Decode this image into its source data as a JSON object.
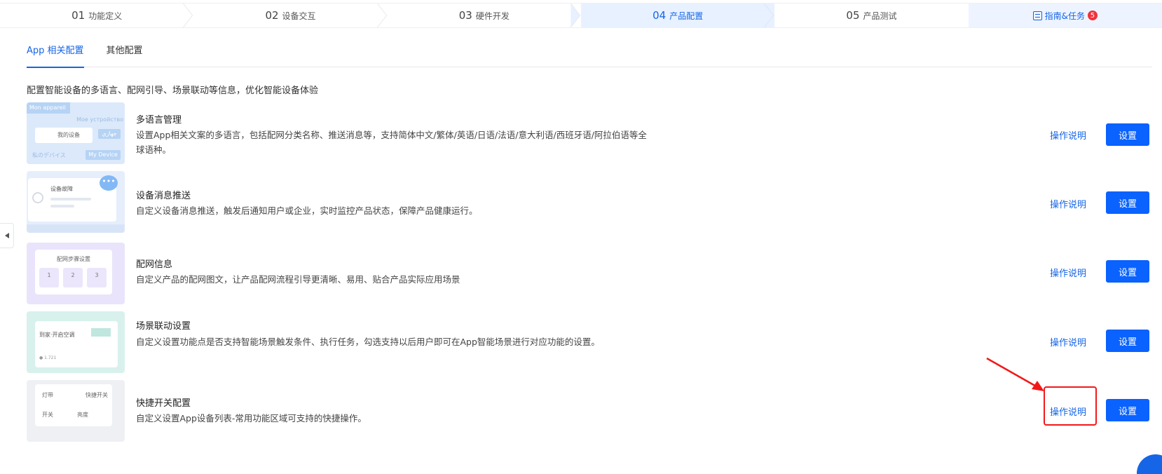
{
  "steps": [
    {
      "num": "01",
      "label": "功能定义"
    },
    {
      "num": "02",
      "label": "设备交互"
    },
    {
      "num": "03",
      "label": "硬件开发"
    },
    {
      "num": "04",
      "label": "产品配置"
    },
    {
      "num": "05",
      "label": "产品测试"
    }
  ],
  "guide": {
    "label": "指南&任务",
    "badge": "5"
  },
  "tabs": [
    {
      "label": "App 相关配置"
    },
    {
      "label": "其他配置"
    }
  ],
  "description": "配置智能设备的多语言、配网引导、场景联动等信息，优化智能设备体验",
  "items": [
    {
      "title": "多语言管理",
      "text": "设置App相关文案的多语言，包括配网分类名称、推送消息等，支持简体中文/繁体/英语/日语/法语/意大利语/西班牙语/阿拉伯语等全球语种。",
      "help": "操作说明",
      "button": "设置",
      "thumb": {
        "a": "Mon appareil",
        "b": "Мое устройство",
        "c": "我的设备",
        "d": "جهازي",
        "e": "私のデバイス",
        "f": "My Device"
      }
    },
    {
      "title": "设备消息推送",
      "text": "自定义设备消息推送，触发后通知用户或企业，实时监控产品状态，保障产品健康运行。",
      "help": "操作说明",
      "button": "设置",
      "thumb": {
        "a": "设备故障",
        "b": "•••"
      }
    },
    {
      "title": "配网信息",
      "text": "自定义产品的配网图文，让产品配网流程引导更清晰、易用、贴合产品实际应用场景",
      "help": "操作说明",
      "button": "设置",
      "thumb": {
        "a": "配网步骤设置",
        "b": "1",
        "c": "2",
        "d": "3"
      }
    },
    {
      "title": "场景联动设置",
      "text": "自定义设置功能点是否支持智能场景触发条件、执行任务，勾选支持以后用户即可在App智能场景进行对应功能的设置。",
      "help": "操作说明",
      "button": "设置",
      "thumb": {
        "a": "到家·开启空调",
        "b": "● 1.721"
      }
    },
    {
      "title": "快捷开关配置",
      "text": "自定义设置App设备列表-常用功能区域可支持的快捷操作。",
      "help": "操作说明",
      "button": "设置",
      "thumb": {
        "a": "灯带",
        "b": "快捷开关",
        "c": "开关",
        "d": "亮度"
      }
    }
  ],
  "colors": {
    "accent": "#1565e6",
    "button": "#0a62ff",
    "highlight": "#f21818",
    "badge": "#f0323c"
  }
}
